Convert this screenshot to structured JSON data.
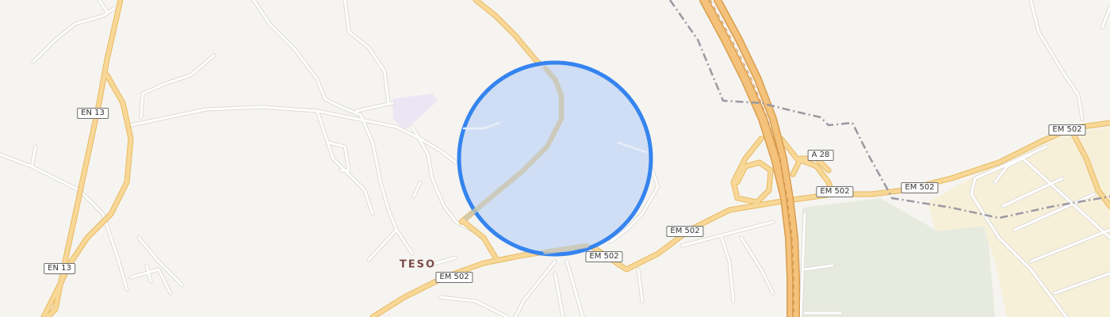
{
  "map": {
    "colors": {
      "background": "#f6f4f0",
      "minor_road": "#ffffff",
      "minor_road_casing": "#dddad4",
      "major_road": "#f7d58d",
      "major_road_casing": "#e8b962",
      "motorway": "#f4c27a",
      "motorway_casing": "#d99d4f",
      "boundary": "#9b98a3",
      "green_area": "#e7ebdf",
      "industrial_area": "#f7f0d9",
      "purple_area": "#ece5f4",
      "accuracy_fill": "#cbdcf4",
      "accuracy_stroke": "#3584ef"
    },
    "road_shields": [
      {
        "id": "en13-north",
        "text": "EN 13"
      },
      {
        "id": "en13-south",
        "text": "EN 13"
      },
      {
        "id": "em502-a",
        "text": "EM 502"
      },
      {
        "id": "em502-b",
        "text": "EM 502"
      },
      {
        "id": "em502-c",
        "text": "EM 502"
      },
      {
        "id": "em502-d",
        "text": "EM 502"
      },
      {
        "id": "em502-e",
        "text": "EM 502"
      },
      {
        "id": "em502-f",
        "text": "EM 502"
      },
      {
        "id": "a28",
        "text": "A 28"
      }
    ],
    "places": [
      {
        "id": "teso",
        "text": "TESO"
      }
    ]
  }
}
